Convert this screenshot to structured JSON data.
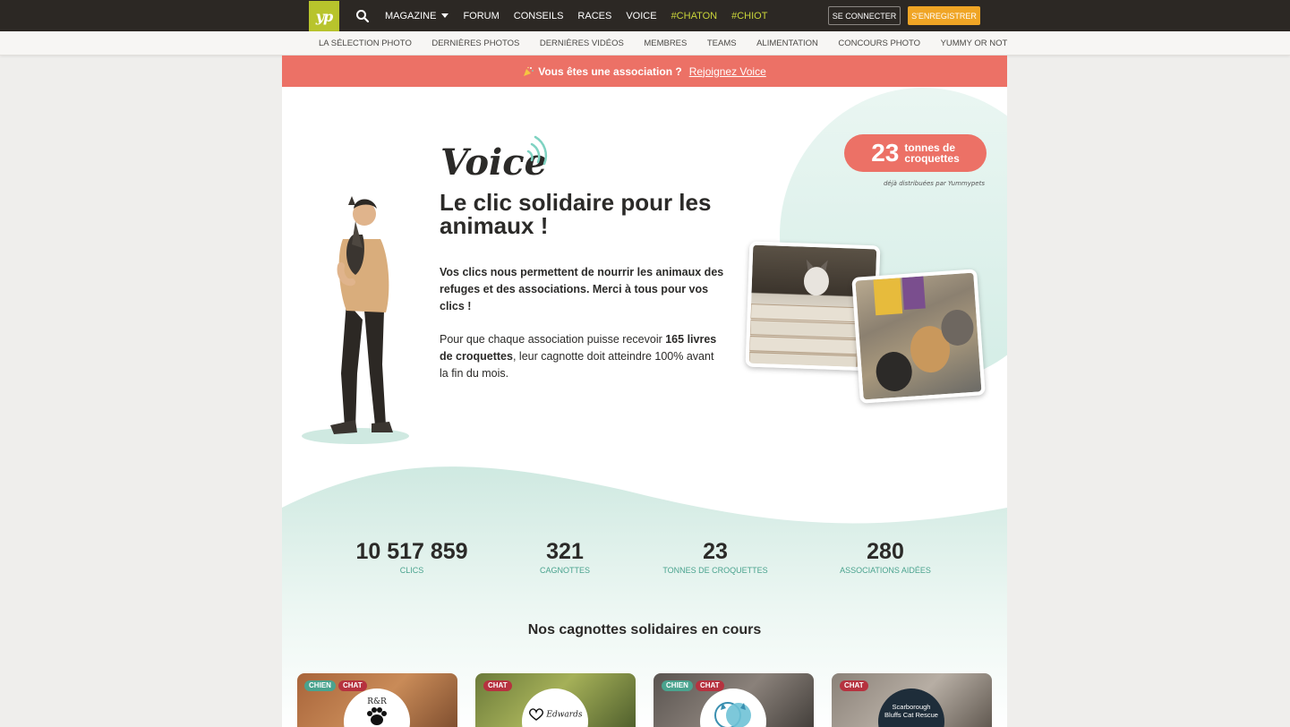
{
  "header": {
    "logo_text": "yp",
    "nav": [
      {
        "label": "MAGAZINE",
        "dropdown": true,
        "highlight": false
      },
      {
        "label": "FORUM",
        "dropdown": false,
        "highlight": false
      },
      {
        "label": "CONSEILS",
        "dropdown": false,
        "highlight": false
      },
      {
        "label": "RACES",
        "dropdown": false,
        "highlight": false
      },
      {
        "label": "VOICE",
        "dropdown": false,
        "highlight": false
      },
      {
        "label": "#CHATON",
        "dropdown": false,
        "highlight": true
      },
      {
        "label": "#CHIOT",
        "dropdown": false,
        "highlight": true
      }
    ],
    "login_label": "SE CONNECTER",
    "register_label": "S'ENREGISTRER"
  },
  "subnav": [
    "LA SÉLECTION PHOTO",
    "DERNIÈRES PHOTOS",
    "DERNIÈRES VIDÉOS",
    "MEMBRES",
    "TEAMS",
    "ALIMENTATION",
    "CONCOURS PHOTO",
    "YUMMY OR NOT"
  ],
  "banner": {
    "question": "Vous êtes une association ?",
    "link": "Rejoignez Voice"
  },
  "hero": {
    "logo_text": "Voice",
    "headline": "Le clic solidaire pour les animaux !",
    "intro": "Vos clics nous permettent de nourrir les animaux des refuges et des associations. Merci à tous pour vos clics !",
    "rule_prefix": "Pour que chaque association puisse recevoir ",
    "rule_bold": "165 livres de croquettes",
    "rule_suffix": ", leur cagnotte doit atteindre 100% avant la fin du mois.",
    "tons_value": "23",
    "tons_label_1": "tonnes de",
    "tons_label_2": "croquettes",
    "tons_sub": "déjà distribuées par Yummypets"
  },
  "stats": [
    {
      "value": "10 517 859",
      "label": "CLICS"
    },
    {
      "value": "321",
      "label": "CAGNOTTES"
    },
    {
      "value": "23",
      "label": "TONNES DE CROQUETTES"
    },
    {
      "value": "280",
      "label": "ASSOCIATIONS AIDÉES"
    }
  ],
  "campaigns_title": "Nos cagnottes solidaires en cours",
  "campaigns": [
    {
      "tags": [
        "CHIEN",
        "CHAT"
      ],
      "logo_text": "R&R"
    },
    {
      "tags": [
        "CHAT"
      ],
      "logo_text": "Edwards"
    },
    {
      "tags": [
        "CHIEN",
        "CHAT"
      ],
      "logo_text": ""
    },
    {
      "tags": [
        "CHAT"
      ],
      "logo_text": "Scarborough Bluffs Cat Rescue"
    }
  ],
  "colors": {
    "topbar": "#2c2824",
    "accent_green": "#c9d43a",
    "register": "#f0a525",
    "coral": "#ec7166",
    "teal": "#4aa38e",
    "cat_tag": "#b6323f"
  }
}
